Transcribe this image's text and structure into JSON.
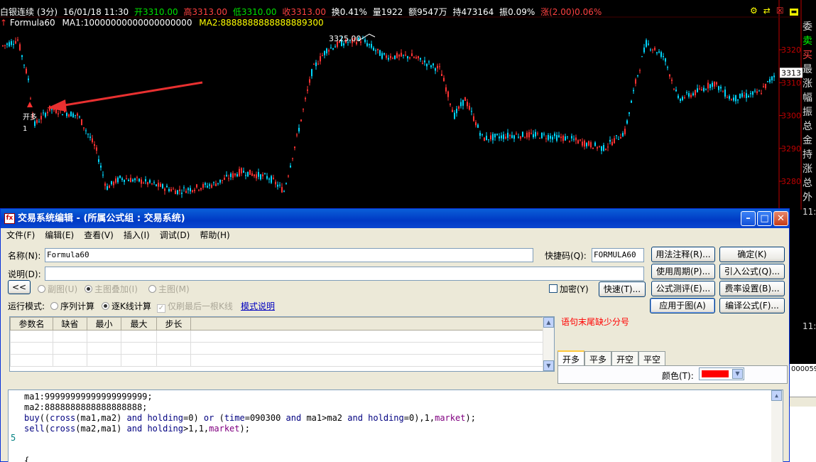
{
  "chart": {
    "header": {
      "symbol": "白银连续",
      "period": "(3分)",
      "datetime": "16/01/18 11:30",
      "open": "开3310.00",
      "high": "高3313.00",
      "low": "低3310.00",
      "close": "收3313.00",
      "change_pct": "换0.41%",
      "volume": "量1922",
      "amount": "额9547万",
      "hold": "持473164",
      "amplitude": "振0.09%",
      "rise": "涨(2.00)0.06%"
    },
    "formula_line": {
      "name": "Formula60",
      "ma1": "MA1:10000000000000000000",
      "ma2": "MA2:8888888888888889300"
    },
    "peak_label": "3325.00",
    "signal_label": "开多",
    "signal_count": "1",
    "price_axis": [
      "3320",
      "3310",
      "3300",
      "3290",
      "3280"
    ],
    "current_price_tag": "3313",
    "colors": {
      "up": "#ff3333",
      "down": "#00d8ff",
      "arrow": "#e83030",
      "axis": "#c00000"
    }
  },
  "right_panel": [
    "委",
    "卖",
    "买",
    "最",
    "涨",
    "幅",
    "振",
    "总",
    "金",
    "持",
    "涨",
    "总",
    "外",
    "11:"
  ],
  "right_panel_lower": [
    "11:",
    "000059"
  ],
  "dialog": {
    "title": "交易系统编辑 - (所属公式组 : 交易系统)",
    "menu": [
      "文件(F)",
      "编辑(E)",
      "查看(V)",
      "插入(I)",
      "调试(D)",
      "帮助(H)"
    ],
    "name_label": "名称(N):",
    "name_value": "Formula60",
    "shortcut_label": "快捷码(Q):",
    "shortcut_value": "FORMULA60",
    "desc_label": "说明(D):",
    "desc_value": "",
    "collapse_btn": "<<",
    "chart_modes": [
      "副图(U)",
      "主图叠加(I)",
      "主图(M)"
    ],
    "encrypt_label": "加密(Y)",
    "quick_btn": "快速(T)...",
    "run_mode_label": "运行模式:",
    "run_modes": [
      "序列计算",
      "逐K线计算"
    ],
    "refresh_label": "仅刷最后一根K线",
    "mode_link": "模式说明",
    "buttons": {
      "usage_note": "用法注释(R)...",
      "confirm": "确定(K)",
      "use_period": "使用周期(P)...",
      "import_formula": "引入公式(Q)...",
      "formula_test": "公式测评(E)...",
      "fee_settings": "费率设置(B)...",
      "apply_to_chart": "应用于图(A)",
      "compile_formula": "编译公式(F)..."
    },
    "param_headers": [
      "参数名",
      "缺省",
      "最小",
      "最大",
      "步长"
    ],
    "error_msg": "语句末尾缺少分号",
    "signal_tabs": [
      "开多",
      "平多",
      "开空",
      "平空"
    ],
    "color_label": "颜色(T):",
    "color_value": "#ff0000",
    "code_lines": [
      "ma1:99999999999999999999;",
      "ma2:8888888888888888888;",
      "buy((cross(ma1,ma2) and holding=0) or (time=090300 and ma1>ma2 and holding=0),1,market);",
      "sell(cross(ma2,ma1) and holding>1,1,market);",
      "",
      "",
      "{"
    ],
    "gutter_marker": "5"
  }
}
